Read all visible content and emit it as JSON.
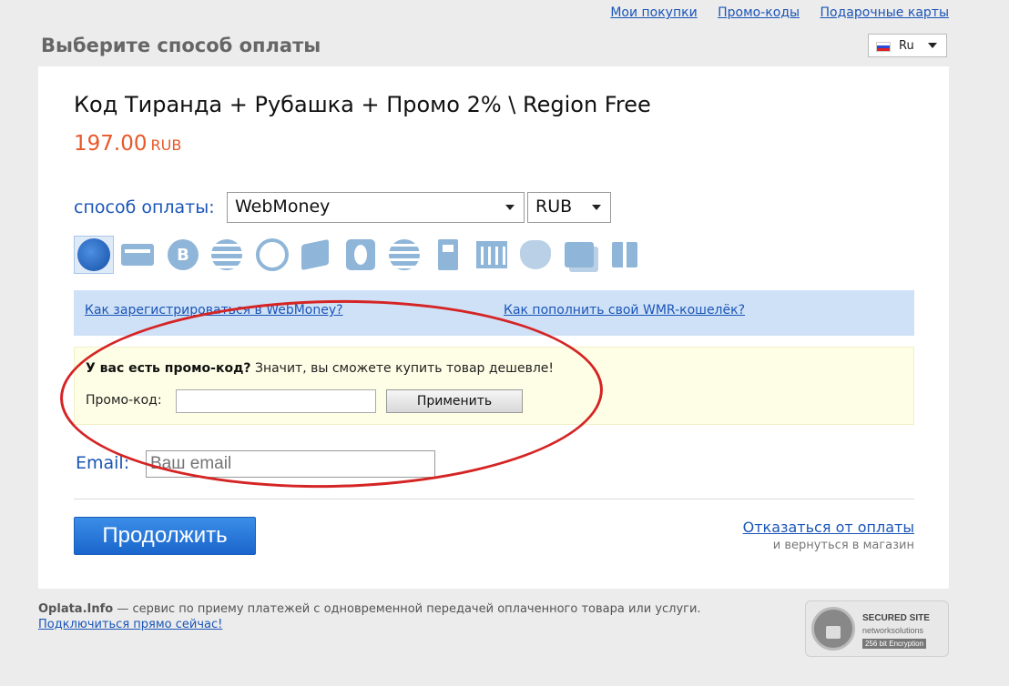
{
  "header": {
    "links": [
      "Мои покупки",
      "Промо-коды",
      "Подарочные карты"
    ],
    "page_title": "Выберите способ оплаты",
    "language": "Ru"
  },
  "product": {
    "title": "Код Тиранда + Рубашка + Промо 2% \\ Region Free",
    "price": "197.00",
    "currency": "RUB"
  },
  "payment": {
    "label": "способ оплаты:",
    "method_selected": "WebMoney",
    "currency_selected": "RUB",
    "method_icons": [
      "webmoney-icon",
      "bank-card-icon",
      "bitcoin-icon",
      "sberbank-icon",
      "qiwi-icon",
      "yandex-money-icon",
      "egg-wallet-icon",
      "striped-circle-icon",
      "terminal-icon",
      "bank-icon",
      "russian-post-icon",
      "multi-card-icon",
      "gift-icon"
    ],
    "bitcoin_glyph": "B",
    "info_links": {
      "register": "Как зарегистрироваться в WebMoney?",
      "topup": "Как пополнить свой WMR-кошелёк?"
    }
  },
  "promo": {
    "question_bold": "У вас есть промо-код?",
    "question_rest": " Значит, вы сможете купить товар дешевле!",
    "label": "Промо-код:",
    "input_value": "",
    "apply_label": "Применить"
  },
  "email": {
    "label": "Email:",
    "placeholder": "Ваш email",
    "value": ""
  },
  "actions": {
    "continue_label": "Продолжить",
    "cancel_label": "Отказаться от оплаты",
    "cancel_sub": "и вернуться в магазин"
  },
  "footer": {
    "brand": "Oplata.Info",
    "description": " — сервис по приему платежей с одновременной передачей оплаченного товара или услуги.",
    "connect_link": "Подключиться прямо сейчас!"
  },
  "seal": {
    "line1": "SECURED SITE",
    "line2": "networksolutions",
    "line3": "256 bit Encryption"
  },
  "colors": {
    "accent_blue": "#1a55b8",
    "price_orange": "#e8582a",
    "annotation_red": "#d52424",
    "info_bar_bg": "#cfe1f7",
    "promo_bg": "#fefee6"
  }
}
